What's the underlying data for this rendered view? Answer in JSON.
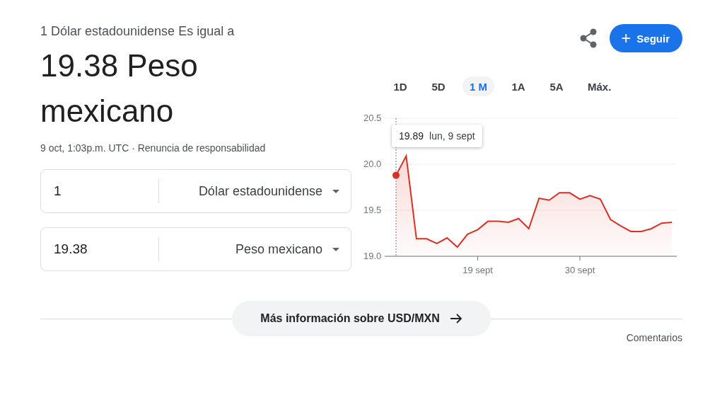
{
  "header": {
    "subtitle": "1 Dólar estadounidense Es igual a",
    "result": "19.38 Peso mexicano",
    "timestamp": "9 oct, 1:03p.m. UTC · ",
    "disclaimer": "Renuncia de responsabilidad"
  },
  "follow_button": {
    "icon": "+",
    "label": "Seguir"
  },
  "converter": [
    {
      "amount": "1",
      "currency": "Dólar estadounidense"
    },
    {
      "amount": "19.38",
      "currency": "Peso mexicano"
    }
  ],
  "range_tabs": [
    {
      "label": "1D",
      "selected": false
    },
    {
      "label": "5D",
      "selected": false
    },
    {
      "label": "1 M",
      "selected": true
    },
    {
      "label": "1A",
      "selected": false
    },
    {
      "label": "5A",
      "selected": false
    },
    {
      "label": "Máx.",
      "selected": false
    }
  ],
  "tooltip": {
    "value": "19.89",
    "date": "lun, 9 sept"
  },
  "chart_data": {
    "type": "area",
    "categories": [
      null,
      null,
      null,
      null,
      null,
      null,
      null,
      null,
      "19 sept",
      null,
      null,
      null,
      null,
      null,
      null,
      null,
      null,
      null,
      "30 sept",
      null,
      null,
      null,
      null,
      null,
      null,
      null,
      null,
      null
    ],
    "series": [
      {
        "color": "#d93025",
        "values": [
          19.88,
          20.09,
          19.19,
          19.19,
          19.14,
          19.2,
          19.1,
          19.24,
          19.29,
          19.38,
          19.38,
          19.37,
          19.41,
          19.3,
          19.63,
          19.61,
          19.69,
          19.69,
          19.62,
          19.66,
          19.62,
          19.4,
          19.33,
          19.27,
          19.27,
          19.3,
          19.36,
          19.37
        ]
      }
    ],
    "ylim": [
      19,
      20.5
    ],
    "yticks": [
      {
        "value": 19,
        "label": "19.0"
      },
      {
        "value": 19.5,
        "label": "19.5"
      },
      {
        "value": 20,
        "label": "20.0"
      },
      {
        "value": 20.5,
        "label": "20.5"
      }
    ]
  },
  "more_button": {
    "label": "Más información sobre USD/MXN"
  },
  "feedback": "Comentarios"
}
